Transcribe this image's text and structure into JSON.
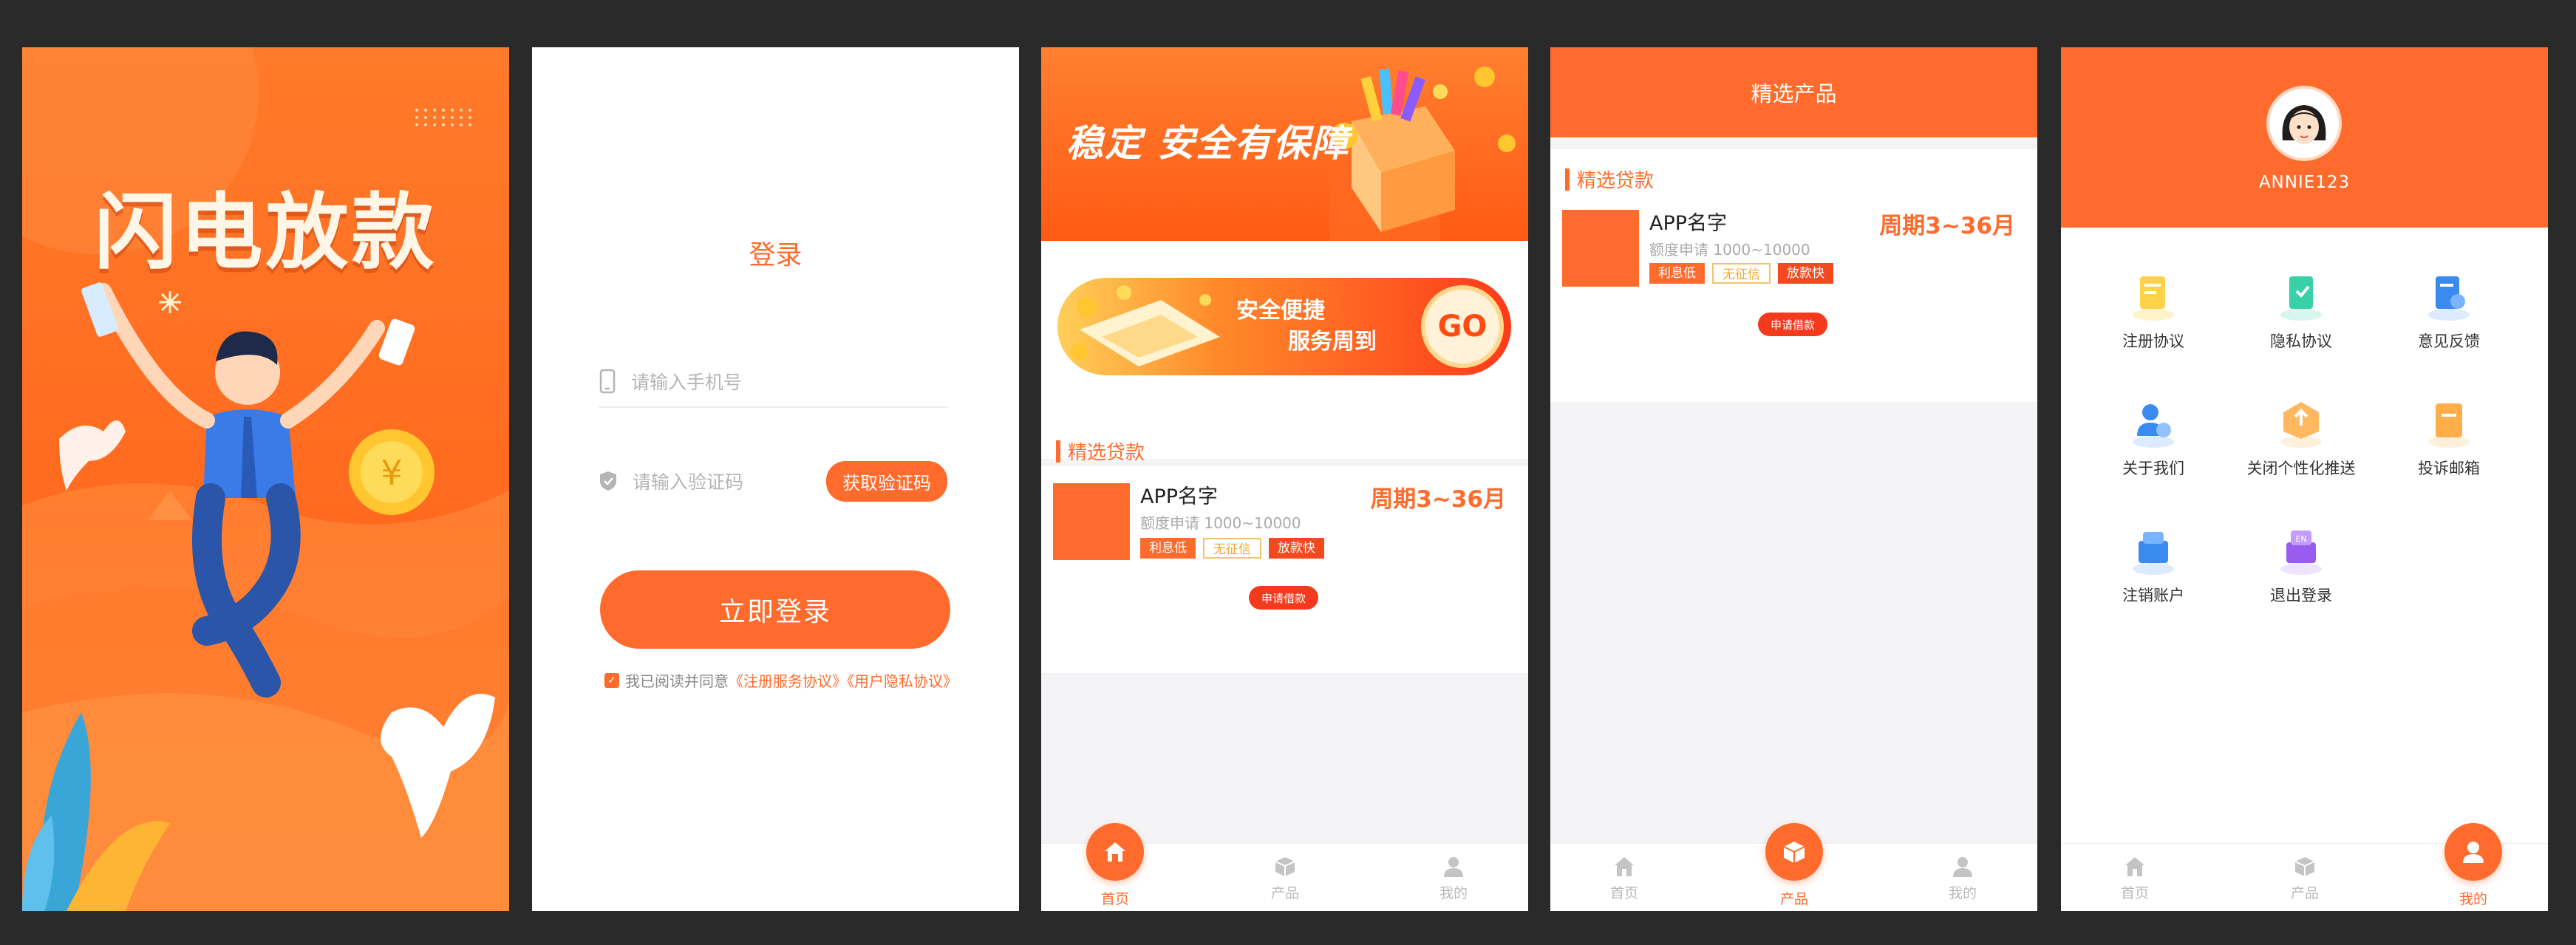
{
  "splash": {
    "title": "闪电放款"
  },
  "login": {
    "title": "登录",
    "phone_placeholder": "请输入手机号",
    "code_placeholder": "请输入验证码",
    "get_code_button": "获取验证码",
    "login_button": "立即登录",
    "agreement_text": "我已阅读并同意",
    "agreement_links": "《注册服务协议》《用户隐私协议》"
  },
  "home": {
    "hero_text": "稳定 安全有保障",
    "banner_line1": "安全便捷",
    "banner_line2": "服务周到",
    "banner_go": "GO",
    "section_title": "精选贷款",
    "loan": {
      "name": "APP名字",
      "period": "周期3~36月",
      "desc": "额度申请 1000~10000",
      "tags": [
        "利息低",
        "无征信",
        "放款快"
      ],
      "apply_button": "申请借款"
    }
  },
  "products": {
    "title": "精选产品",
    "section_title": "精选贷款",
    "loan": {
      "name": "APP名字",
      "period": "周期3~36月",
      "desc": "额度申请 1000~10000",
      "tags": [
        "利息低",
        "无征信",
        "放款快"
      ],
      "apply_button": "申请借款"
    }
  },
  "mine": {
    "username": "ANNIE123",
    "menu": [
      {
        "label": "注册协议",
        "icon": "register-agreement-icon"
      },
      {
        "label": "隐私协议",
        "icon": "privacy-agreement-icon"
      },
      {
        "label": "意见反馈",
        "icon": "feedback-icon"
      },
      {
        "label": "关于我们",
        "icon": "about-us-icon"
      },
      {
        "label": "关闭个性化推送",
        "icon": "push-off-icon"
      },
      {
        "label": "投诉邮箱",
        "icon": "complaint-mail-icon"
      },
      {
        "label": "注销账户",
        "icon": "cancel-account-icon"
      },
      {
        "label": "退出登录",
        "icon": "logout-icon"
      }
    ]
  },
  "tabs": {
    "home": "首页",
    "product": "产品",
    "mine": "我的"
  },
  "colors": {
    "brand": "#ff6b2c",
    "tag_red": "#f4481e",
    "tag_yellow": "#f4c36a",
    "background": "#2a2a2a"
  }
}
